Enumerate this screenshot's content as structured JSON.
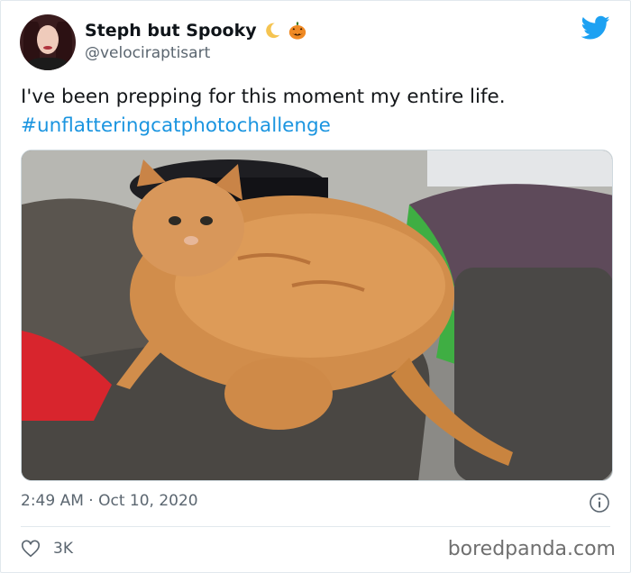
{
  "author": {
    "display_name": "Steph but Spooky",
    "handle": "@velociraptisart",
    "name_emojis": [
      "crescent-moon",
      "jack-o-lantern"
    ]
  },
  "tweet": {
    "text": "I've been prepping for this moment my entire life.",
    "hashtag": "#unflatteringcatphotochallenge",
    "timestamp": "2:49 AM · Oct 10, 2020",
    "like_count": "3K"
  },
  "icons": {
    "brand": "twitter-bird-icon",
    "info": "info-icon",
    "like": "heart-icon"
  },
  "colors": {
    "twitter_blue": "#1da1f2",
    "hashtag": "#1b95e0",
    "muted_text": "#5b6670"
  },
  "watermark": "boredpanda.com"
}
